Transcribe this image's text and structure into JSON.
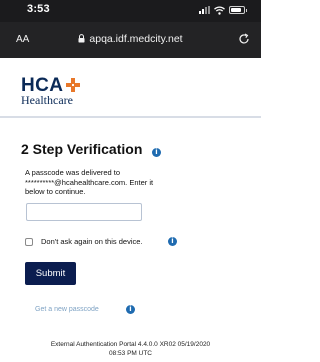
{
  "status_bar": {
    "time": "3:53"
  },
  "browser": {
    "text_size_label": "AA",
    "url": "apqa.idf.medcity.net"
  },
  "header": {
    "logo_hca": "HCA",
    "logo_healthcare": "Healthcare"
  },
  "main": {
    "title": "2 Step Verification",
    "instructions_line1": "A passcode was delivered to",
    "instructions_line2": "**********@hcahealthcare.com. Enter it",
    "instructions_line3": "below to continue.",
    "passcode_value": "",
    "remember_label": "Don't ask again on this device.",
    "submit_label": "Submit",
    "new_passcode_link": "Get a new passcode"
  },
  "footer": {
    "line1": "External Authentication Portal 4.4.0.0 XR02 05/19/2020",
    "line2": "08:53 PM UTC"
  },
  "colors": {
    "brand_navy": "#0b1d4f",
    "brand_orange": "#e8782a",
    "info_blue": "#1f6bb0",
    "link_blue": "#7fa3c4"
  }
}
